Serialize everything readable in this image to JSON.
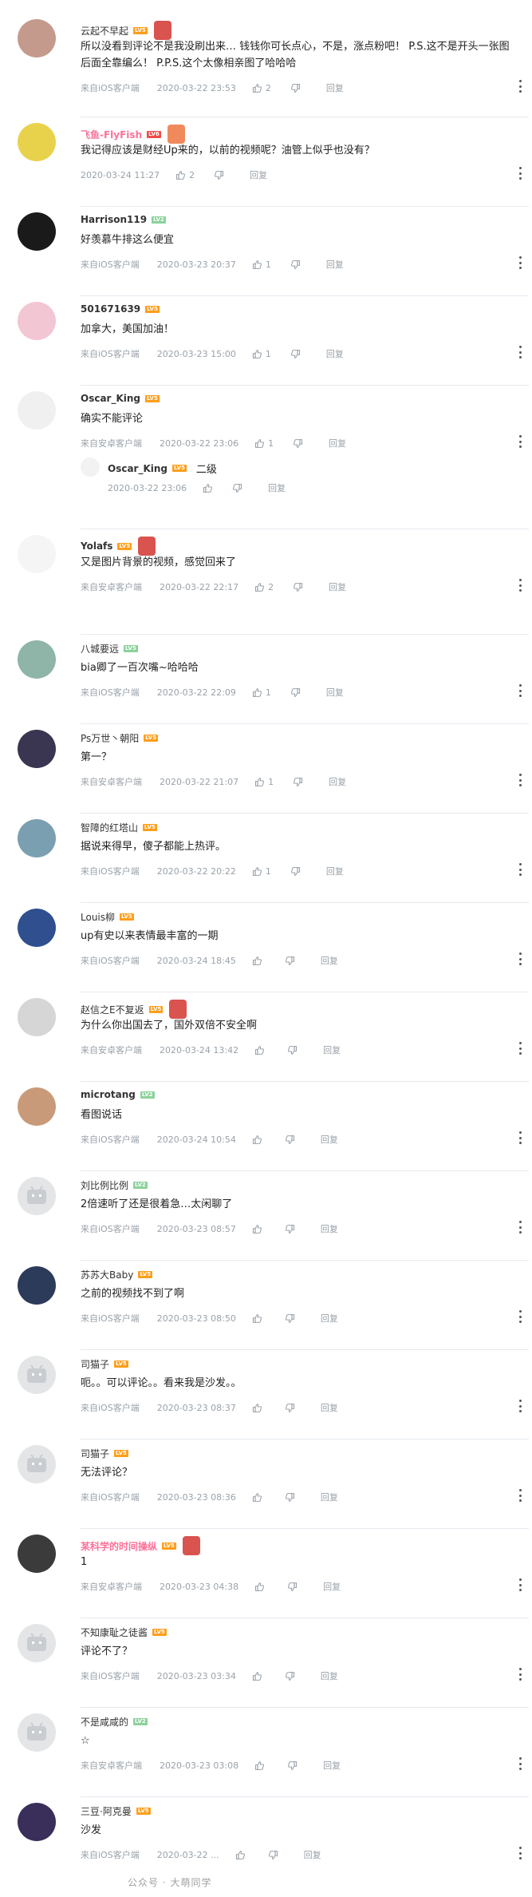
{
  "labels": {
    "reply": "回复"
  },
  "watermark": "公众号 · 大萌同学",
  "comments": [
    {
      "name": "云起不早起",
      "level": "LV5",
      "level_color": "#ff9e1b",
      "text": "所以没看到评论不是我没刷出来… 钱钱你可长点心，不是，涨点粉吧！ P.S.这不是开头一张图后面全靠编么！ P.P.S.这个太像相亲图了哈哈哈",
      "source": "来自iOS客户端",
      "time": "2020-03-22 23:53",
      "likes": "2",
      "avatar_color": "#c49a8c"
    },
    {
      "name": "飞鱼-FlyFish",
      "level": "LV6",
      "level_color": "#f04c49",
      "vip": true,
      "text": "我记得应该是财经Up来的，以前的视频呢？油管上似乎也没有？",
      "source": "",
      "time": "2020-03-24 11:27",
      "likes": "2",
      "avatar_color": "#e9d24b"
    },
    {
      "name": "Harrison119",
      "level": "LV2",
      "level_color": "#8bd29b",
      "bold": true,
      "text": "好羡慕牛排这么便宜",
      "source": "来自iOS客户端",
      "time": "2020-03-23 20:37",
      "likes": "1",
      "avatar_color": "#1a1a1a"
    },
    {
      "name": "501671639",
      "level": "LV5",
      "level_color": "#ff9e1b",
      "bold": true,
      "text": "加拿大，美国加油！",
      "source": "来自iOS客户端",
      "time": "2020-03-23 15:00",
      "likes": "1",
      "avatar_color": "#f2c6d3"
    },
    {
      "name": "Oscar_King",
      "level": "LV5",
      "level_color": "#ff9e1b",
      "bold": true,
      "text": "确实不能评论",
      "source": "来自安卓客户端",
      "time": "2020-03-22 23:06",
      "likes": "1",
      "avatar_color": "#f0f0f0",
      "sub": {
        "name": "Oscar_King",
        "level": "LV5",
        "text": "二级",
        "time": "2020-03-22 23:06"
      }
    },
    {
      "name": "Yolafs",
      "level": "LV5",
      "level_color": "#ff9e1b",
      "bold": true,
      "text": "又是图片背景的视频，感觉回来了",
      "source": "来自安卓客户端",
      "time": "2020-03-22 22:17",
      "likes": "2",
      "avatar_color": "#f5f5f5"
    },
    {
      "name": "八城要远",
      "level": "LV5",
      "level_color": "#8bd29b",
      "text": "bia卿了一百次嘴~哈哈哈",
      "source": "来自iOS客户端",
      "time": "2020-03-22 22:09",
      "likes": "1",
      "avatar_color": "#8fb5a8"
    },
    {
      "name": "Ps万世丶朝阳",
      "level": "LV5",
      "level_color": "#ff9e1b",
      "text": "第一？",
      "source": "来自安卓客户端",
      "time": "2020-03-22 21:07",
      "likes": "1",
      "avatar_color": "#3a3550"
    },
    {
      "name": "智障的红塔山",
      "level": "LV5",
      "level_color": "#ff9e1b",
      "text": "据说来得早，傻子都能上热评。",
      "source": "来自iOS客户端",
      "time": "2020-03-22 20:22",
      "likes": "1",
      "avatar_color": "#7a9fb0"
    },
    {
      "name": "Louis柳",
      "level": "LV5",
      "level_color": "#ff9e1b",
      "text": "up有史以来表情最丰富的一期",
      "source": "来自iOS客户端",
      "time": "2020-03-24 18:45",
      "likes": "",
      "avatar_color": "#2f4f8f"
    },
    {
      "name": "赵信之E不复返",
      "level": "LV5",
      "level_color": "#ff9e1b",
      "text": "为什么你出国去了，国外双倍不安全啊",
      "source": "来自安卓客户端",
      "time": "2020-03-24 13:42",
      "likes": "",
      "avatar_color": "#d6d6d6"
    },
    {
      "name": "microtang",
      "level": "LV2",
      "level_color": "#8bd29b",
      "bold": true,
      "text": "看图说话",
      "source": "来自iOS客户端",
      "time": "2020-03-24 10:54",
      "likes": "",
      "avatar_color": "#c99a7a"
    },
    {
      "name": "刘比例比例",
      "level": "LV2",
      "level_color": "#8bd29b",
      "text": "2倍速听了还是很着急…太闲聊了",
      "source": "来自iOS客户端",
      "time": "2020-03-23 08:57",
      "likes": "",
      "avatar_color": "#e3e5e7"
    },
    {
      "name": "苏苏大Baby",
      "level": "LV5",
      "level_color": "#ff9e1b",
      "text": "之前的视频找不到了啊",
      "source": "来自iOS客户端",
      "time": "2020-03-23 08:50",
      "likes": "",
      "avatar_color": "#2d3b5a"
    },
    {
      "name": "司猫子",
      "level": "LV5",
      "level_color": "#ff9e1b",
      "text": "呃。。可以评论。。看来我是沙发。。",
      "source": "来自iOS客户端",
      "time": "2020-03-23 08:37",
      "likes": "",
      "avatar_color": "#e3e5e7"
    },
    {
      "name": "司猫子",
      "level": "LV5",
      "level_color": "#ff9e1b",
      "text": "无法评论？",
      "source": "来自iOS客户端",
      "time": "2020-03-23 08:36",
      "likes": "",
      "avatar_color": "#e3e5e7"
    },
    {
      "name": "某科学的时间操纵",
      "level": "LV5",
      "level_color": "#ff9e1b",
      "vip": true,
      "text": "1",
      "source": "来自安卓客户端",
      "time": "2020-03-23 04:38",
      "likes": "",
      "avatar_color": "#3b3b3b"
    },
    {
      "name": "不知康耻之徒酱",
      "level": "LV5",
      "level_color": "#ff9e1b",
      "text": "评论不了？",
      "source": "来自iOS客户端",
      "time": "2020-03-23 03:34",
      "likes": "",
      "avatar_color": "#e3e5e7"
    },
    {
      "name": "不是咸咸的",
      "level": "LV2",
      "level_color": "#8bd29b",
      "text": "☆",
      "source": "来自安卓客户端",
      "time": "2020-03-23 03:08",
      "likes": "",
      "avatar_color": "#e3e5e7"
    },
    {
      "name": "三豆·阿克曼",
      "level": "LV5",
      "level_color": "#ff9e1b",
      "text": "沙发",
      "source": "来自iOS客户端",
      "time": "2020-03-22 ...",
      "likes": "",
      "avatar_color": "#3a2f5a"
    }
  ]
}
